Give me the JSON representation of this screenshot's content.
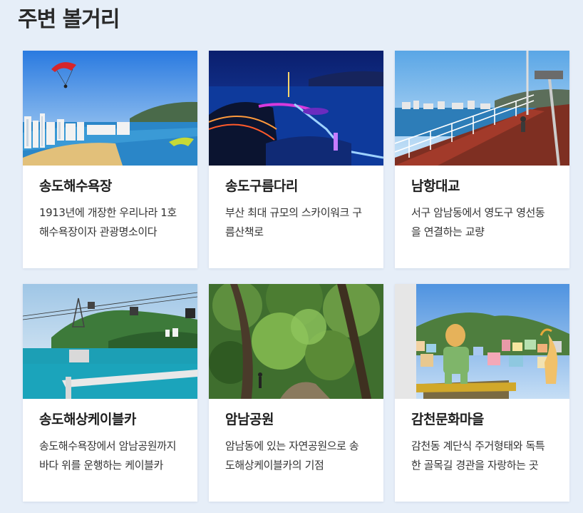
{
  "section_title": "주변 볼거리",
  "cards": [
    {
      "title": "송도해수욕장",
      "desc": "1913년에 개장한 우리나라 1호 해수욕장이자 관광명소이다"
    },
    {
      "title": "송도구름다리",
      "desc": "부산 최대 규모의 스카이워크 구름산책로"
    },
    {
      "title": "남항대교",
      "desc": "서구 암남동에서 영도구 영선동을 연결하는 교량"
    },
    {
      "title": "송도해상케이블카",
      "desc": "송도해수욕장에서 암남공원까지 바다 위를 운행하는 케이블카"
    },
    {
      "title": "암남공원",
      "desc": "암남동에 있는 자연공원으로 송도해상케이블카의 기점"
    },
    {
      "title": "감천문화마을",
      "desc": "감천동 계단식 주거형태와 독특한 골목길 경관을 자랑하는 곳"
    }
  ]
}
